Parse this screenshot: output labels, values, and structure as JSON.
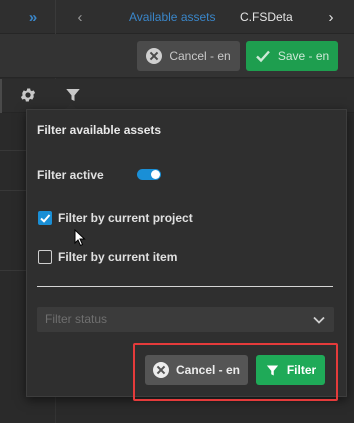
{
  "topbar": {
    "collapse_glyph": "»",
    "back_glyph": "‹",
    "breadcrumb_link": "Available assets",
    "breadcrumb_current": "C.FSDeta",
    "forward_glyph": "›"
  },
  "actions": {
    "cancel_label": "Cancel - en",
    "save_label": "Save - en"
  },
  "toolbar": {
    "icons": [
      "gear-icon",
      "filter-icon"
    ]
  },
  "popover": {
    "title": "Filter available assets",
    "filter_active_label": "Filter active",
    "filter_active": true,
    "by_project_label": "Filter by current project",
    "by_project_checked": true,
    "by_item_label": "Filter by current item",
    "by_item_checked": false,
    "status_placeholder": "Filter status",
    "cancel_label": "Cancel - en",
    "filter_label": "Filter"
  },
  "colors": {
    "accent_blue": "#1a8fd6",
    "link_blue": "#3a86c9",
    "save_green": "#1e9e4f",
    "filter_green": "#1faa58",
    "highlight_red": "#e53b3b"
  }
}
